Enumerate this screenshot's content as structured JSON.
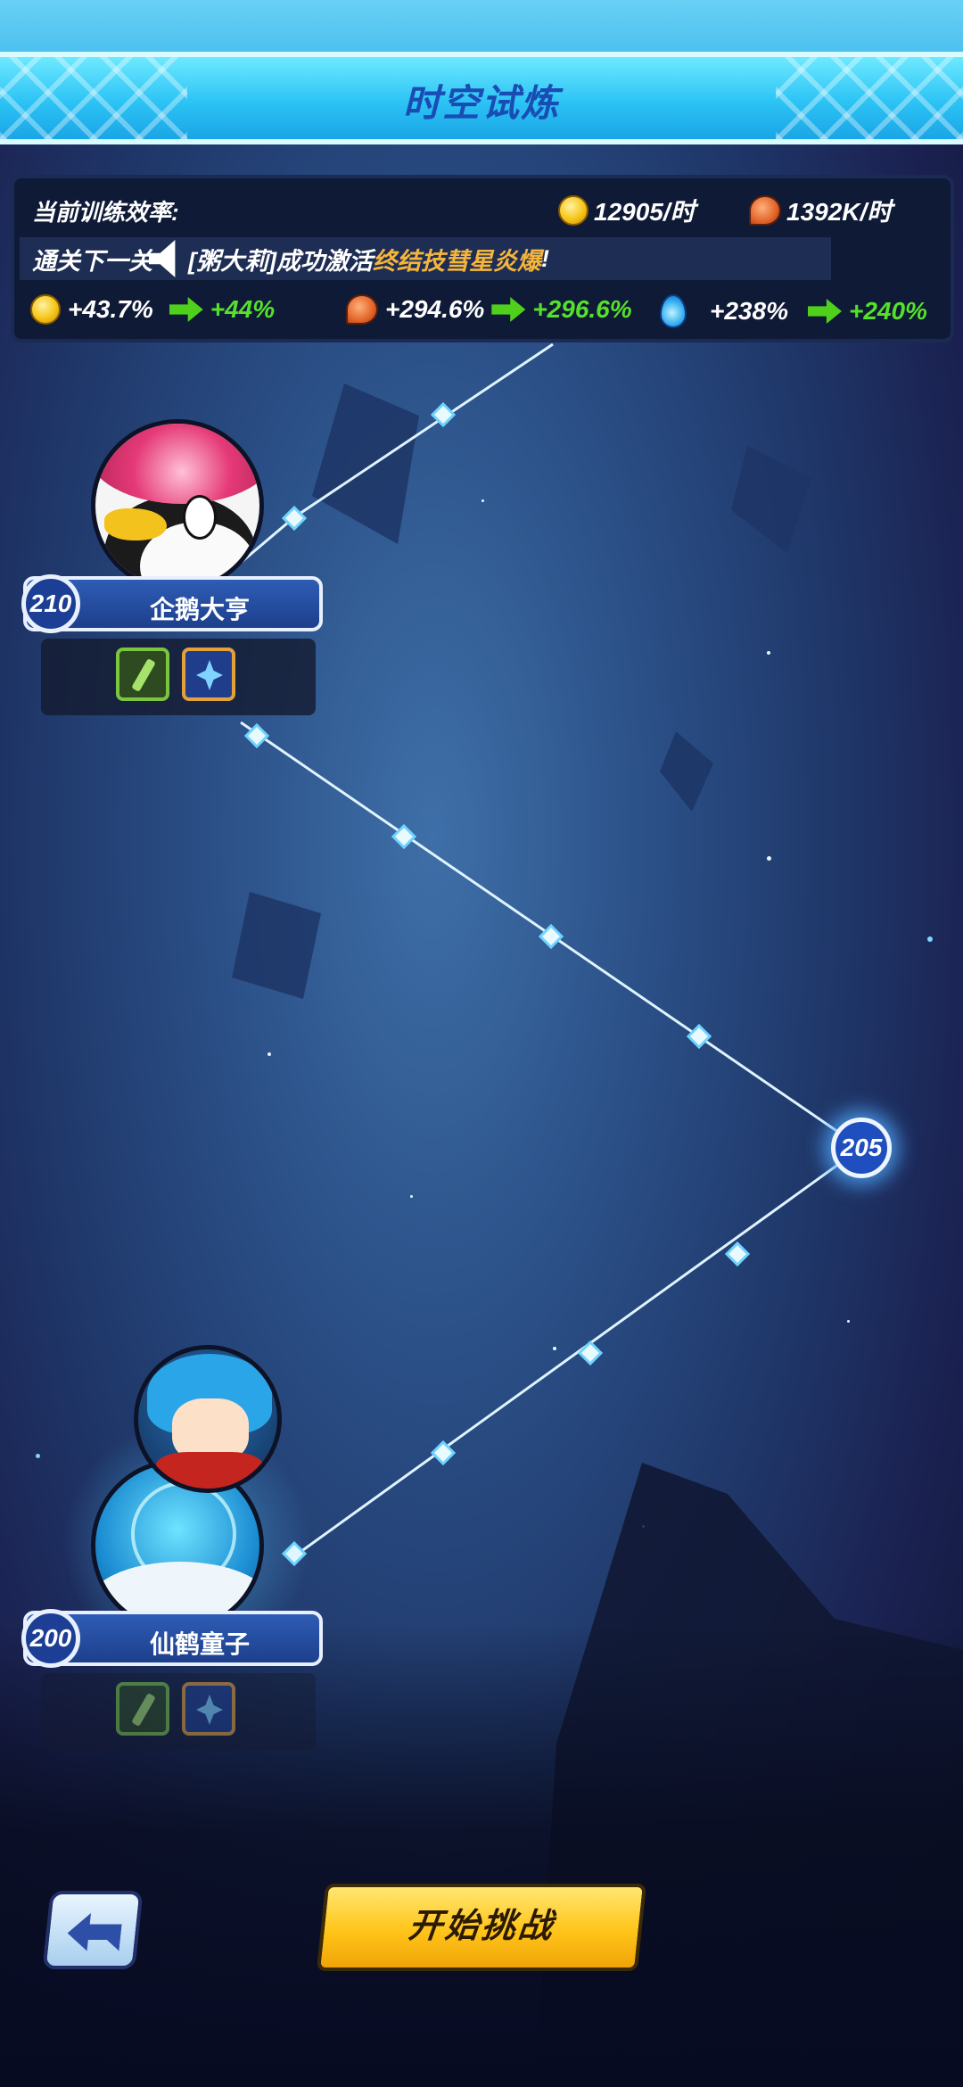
{
  "header": {
    "title": "时空试炼"
  },
  "efficiency": {
    "label": "当前训练效率:",
    "coin_rate": "12905/时",
    "meat_rate": "1392K/时"
  },
  "notice": {
    "prefix": "通关下一关",
    "text": "[粥大莉]成功激活",
    "highlight": "终结技彗星炎爆",
    "suffix": "!"
  },
  "bonuses": {
    "coin_current": "+43.7%",
    "coin_next": "+44%",
    "meat_current": "+294.6%",
    "meat_next": "+296.6%",
    "water_current": "+238%",
    "water_next": "+240%"
  },
  "levels": {
    "top": {
      "number": "210",
      "boss_name": "企鹅大亨"
    },
    "middle": {
      "number": "205"
    },
    "bottom": {
      "number": "200",
      "boss_name": "仙鹤童子"
    }
  },
  "buttons": {
    "start_label": "开始挑战"
  },
  "colors": {
    "title_banner": "#2cc3f5",
    "notice_highlight": "#f5b53b",
    "bonus_green": "#55e12a",
    "start_button": "#ffc419"
  },
  "icons": [
    "coin-icon",
    "meat-icon",
    "blue-drop-icon",
    "arrow-icon",
    "speaker-icon",
    "back-arrow-icon",
    "dagger-icon",
    "crystal-star-icon"
  ]
}
